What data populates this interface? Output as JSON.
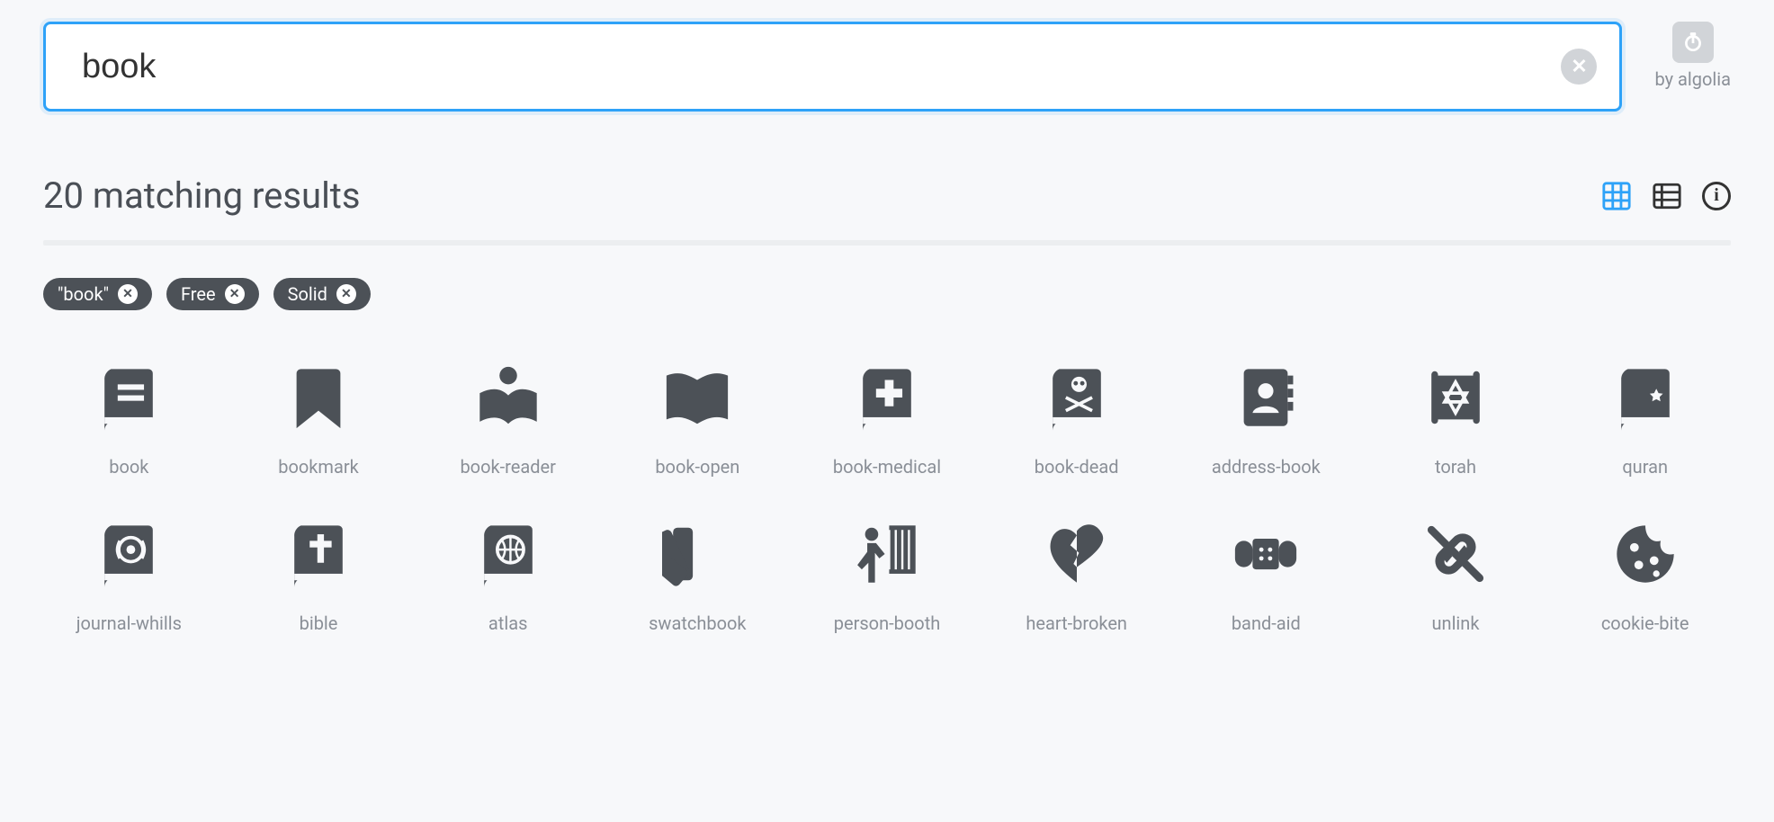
{
  "search": {
    "value": "book",
    "placeholder": ""
  },
  "algolia_label": "by algolia",
  "results_title": "20 matching results",
  "view": {
    "active": "grid"
  },
  "filters": [
    {
      "label": "\"book\""
    },
    {
      "label": "Free"
    },
    {
      "label": "Solid"
    }
  ],
  "icons": [
    {
      "name": "book",
      "label": "book"
    },
    {
      "name": "bookmark",
      "label": "bookmark"
    },
    {
      "name": "book-reader",
      "label": "book-reader"
    },
    {
      "name": "book-open",
      "label": "book-open"
    },
    {
      "name": "book-medical",
      "label": "book-medical"
    },
    {
      "name": "book-dead",
      "label": "book-dead"
    },
    {
      "name": "address-book",
      "label": "address-book"
    },
    {
      "name": "torah",
      "label": "torah"
    },
    {
      "name": "quran",
      "label": "quran"
    },
    {
      "name": "journal-whills",
      "label": "journal-whills"
    },
    {
      "name": "bible",
      "label": "bible"
    },
    {
      "name": "atlas",
      "label": "atlas"
    },
    {
      "name": "swatchbook",
      "label": "swatchbook"
    },
    {
      "name": "person-booth",
      "label": "person-booth"
    },
    {
      "name": "heart-broken",
      "label": "heart-broken"
    },
    {
      "name": "band-aid",
      "label": "band-aid"
    },
    {
      "name": "unlink",
      "label": "unlink"
    },
    {
      "name": "cookie-bite",
      "label": "cookie-bite"
    }
  ]
}
